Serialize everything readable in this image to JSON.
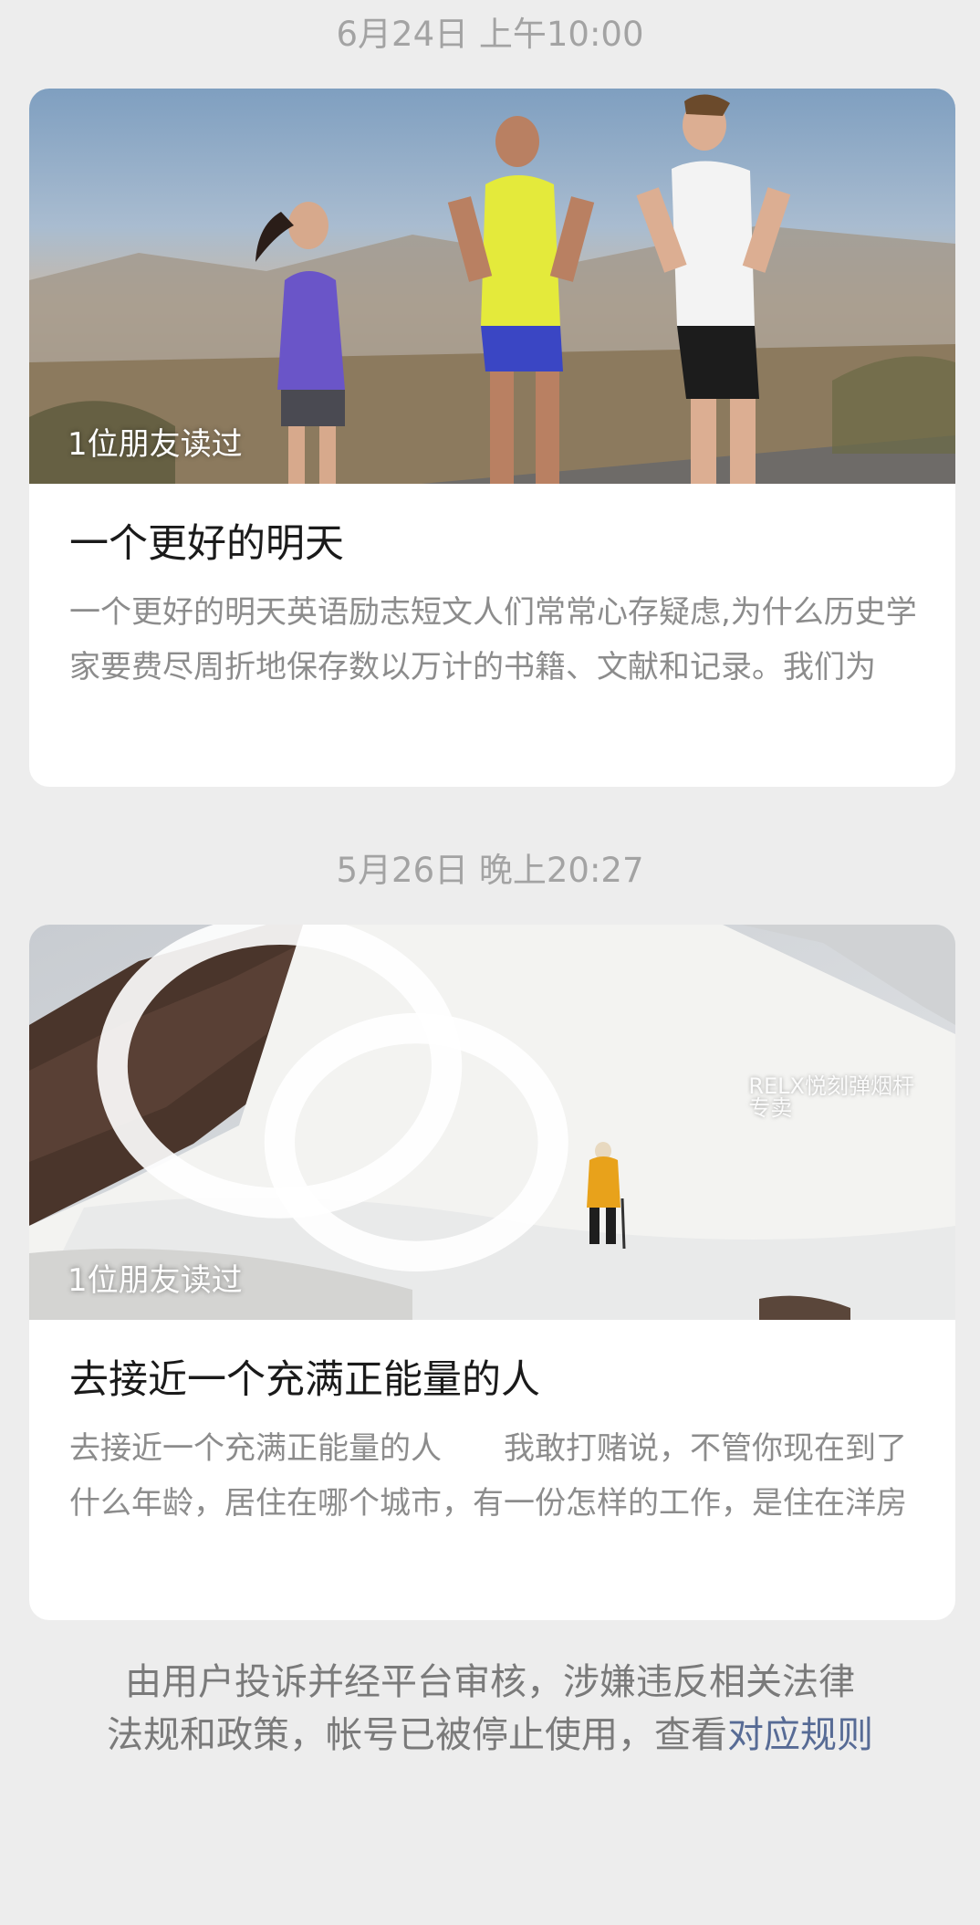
{
  "feed": {
    "items": [
      {
        "timestamp": "6月24日 上午10:00",
        "read_count": "1位朋友读过",
        "title": "一个更好的明天",
        "excerpt": "一个更好的明天英语励志短文人们常常心存疑虑,为什么历史学家要费尽周折地保存数以万计的书籍、文献和记录。我们为"
      },
      {
        "timestamp": "5月26日 晚上20:27",
        "read_count": "1位朋友读过",
        "watermark": "RELX悦刻弹烟杆专卖",
        "watermark_icon": "wechat-icon",
        "title": "去接近一个充满正能量的人",
        "excerpt": "去接近一个充满正能量的人　　我敢打赌说，不管你现在到了什么年龄，居住在哪个城市，有一份怎样的工作，是住在洋房"
      }
    ]
  },
  "footer": {
    "notice_line1": "由用户投诉并经平台审核，涉嫌违反相关法律",
    "notice_line2_prefix": "法规和政策，帐号已被停止使用，查看",
    "rules_link": "对应规则"
  },
  "colors": {
    "page_background": "#ededed",
    "card_background": "#ffffff",
    "timestamp_text": "#a3a3a3",
    "link": "#576b95"
  }
}
